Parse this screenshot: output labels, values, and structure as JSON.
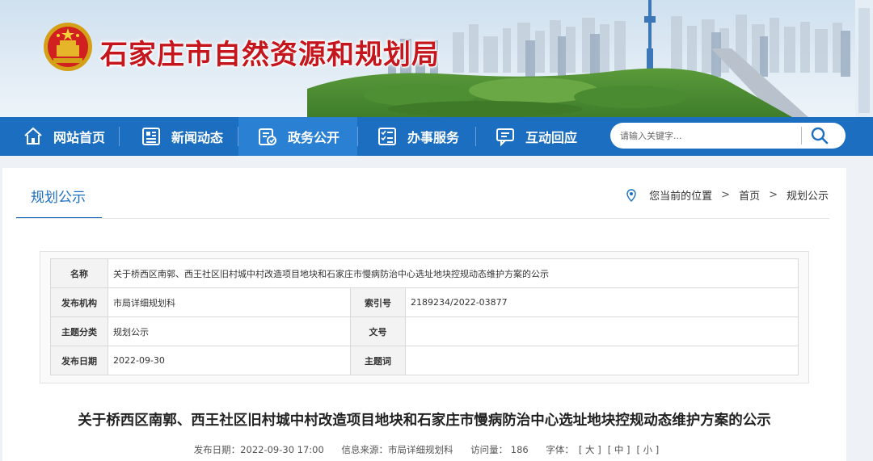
{
  "header": {
    "site_title": "石家庄市自然资源和规划局"
  },
  "nav": {
    "items": [
      {
        "label": "网站首页",
        "icon": "home-icon"
      },
      {
        "label": "新闻动态",
        "icon": "news-icon"
      },
      {
        "label": "政务公开",
        "icon": "gov-affairs-icon",
        "active": true
      },
      {
        "label": "办事服务",
        "icon": "service-list-icon"
      },
      {
        "label": "互动回应",
        "icon": "chat-icon"
      }
    ]
  },
  "search": {
    "placeholder": "请输入关键字..."
  },
  "panel": {
    "tab_label": "规划公示",
    "breadcrumb": {
      "prefix": "您当前的位置",
      "home": "首页",
      "current": "规划公示"
    }
  },
  "meta": {
    "name_label": "名称",
    "name_value": "关于桥西区南郭、西王社区旧村城中村改造项目地块和石家庄市慢病防治中心选址地块控规动态维护方案的公示",
    "org_label": "发布机构",
    "org_value": "市局详细规划科",
    "index_label": "索引号",
    "index_value": "2189234/2022-03877",
    "topic_label": "主题分类",
    "topic_value": "规划公示",
    "docno_label": "文号",
    "docno_value": "",
    "date_label": "发布日期",
    "date_value": "2022-09-30",
    "keyword_label": "主题词",
    "keyword_value": ""
  },
  "article": {
    "title": "关于桥西区南郭、西王社区旧村城中村改造项目地块和石家庄市慢病防治中心选址地块控规动态维护方案的公示",
    "publish_time": "发布日期：2022-09-30 17:00",
    "source": "信息来源：市局详细规划科",
    "views": "访问量：  186",
    "font_label": "字体：",
    "font_large": "[ 大 ]",
    "font_medium": "[ 中 ]",
    "font_small": "[ 小 ]"
  },
  "colors": {
    "brand_blue": "#1c6fc0",
    "title_red": "#c5161d"
  }
}
